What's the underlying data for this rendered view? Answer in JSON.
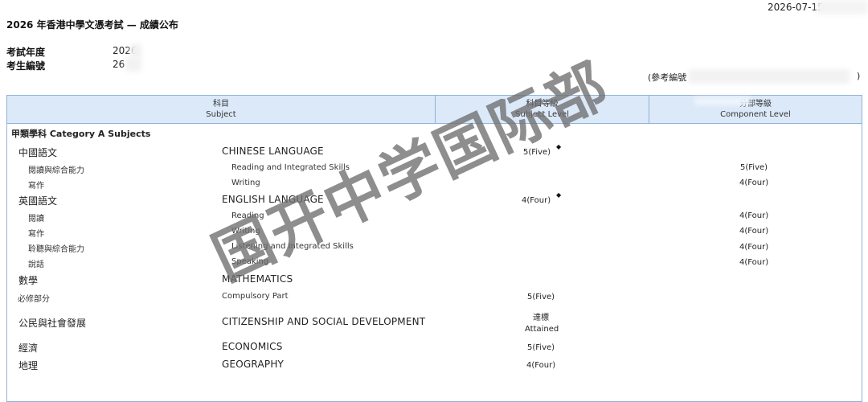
{
  "header": {
    "date": "2026-07-15",
    "title": "2026 年香港中學文憑考試 — 成績公布",
    "exam_year_label": "考試年度",
    "exam_year_value": "2026",
    "candidate_no_label": "考生編號",
    "candidate_no_value": "26",
    "reference_label": "(參考編號",
    "reference_close": ")"
  },
  "table_header": {
    "subject_zh": "科目",
    "subject_en": "Subject",
    "subject_level_zh": "科目等級",
    "subject_level_en": "Subject Level",
    "component_level_zh": "分部等級",
    "component_level_en": "Component Level"
  },
  "category": "甲類學科 Category A Subjects",
  "rows": [
    {
      "zh": "中國語文",
      "en": "CHINESE LANGUAGE",
      "level": "5(Five)",
      "mark": "◆",
      "component": ""
    },
    {
      "zh": "閱讀與綜合能力",
      "en": "Reading and Integrated Skills",
      "level": "",
      "mark": "",
      "component": "5(Five)"
    },
    {
      "zh": "寫作",
      "en": "Writing",
      "level": "",
      "mark": "",
      "component": "4(Four)"
    },
    {
      "zh": "英國語文",
      "en": "ENGLISH LANGUAGE",
      "level": "4(Four)",
      "mark": "◆",
      "component": ""
    },
    {
      "zh": "閱讀",
      "en": "Reading",
      "level": "",
      "mark": "",
      "component": "4(Four)"
    },
    {
      "zh": "寫作",
      "en": "Writing",
      "level": "",
      "mark": "",
      "component": "4(Four)"
    },
    {
      "zh": "聆聽與綜合能力",
      "en": "Listening and Integrated Skills",
      "level": "",
      "mark": "",
      "component": "4(Four)"
    },
    {
      "zh": "說話",
      "en": "Speaking",
      "level": "",
      "mark": "",
      "component": "4(Four)"
    },
    {
      "zh": "數學",
      "en": "MATHEMATICS",
      "level": "",
      "mark": "",
      "component": ""
    },
    {
      "zh": "必修部分",
      "en": "Compulsory Part",
      "level": "5(Five)",
      "mark": "",
      "component": ""
    },
    {
      "zh": "公民與社會發展",
      "en": "CITIZENSHIP AND SOCIAL DEVELOPMENT",
      "level": "達標",
      "level_en": "Attained",
      "mark": "",
      "component": ""
    },
    {
      "zh": "經濟",
      "en": "ECONOMICS",
      "level": "5(Five)",
      "mark": "",
      "component": ""
    },
    {
      "zh": "地理",
      "en": "GEOGRAPHY",
      "level": "4(Four)",
      "mark": "",
      "component": ""
    }
  ],
  "watermark": "国开中学国际部"
}
